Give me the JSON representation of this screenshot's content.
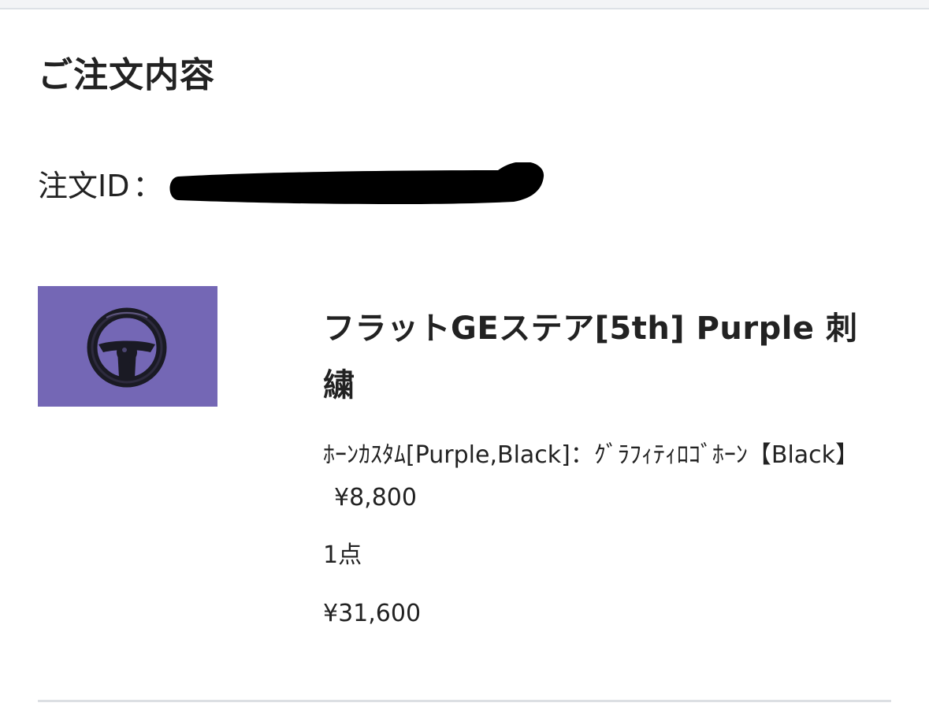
{
  "section": {
    "title": "ご注文内容"
  },
  "order": {
    "id_label": "注文ID",
    "id_separator": "：",
    "id_value": ""
  },
  "product": {
    "thumbnail_icon": "steering-wheel-icon",
    "thumbnail_bg": "#7467b5",
    "name": "フラットGEステア[5th] Purple 刺繍",
    "option_text": "ﾎｰﾝｶｽﾀﾑ[Purple,Black]：ｸﾞﾗﾌｨﾃｨﾛｺﾞﾎｰﾝ【Black】",
    "option_price": "¥8,800",
    "quantity": "1点",
    "total": "¥31,600"
  },
  "colors": {
    "text": "#222222",
    "divider": "#dcdfe3",
    "redaction": "#000000"
  }
}
